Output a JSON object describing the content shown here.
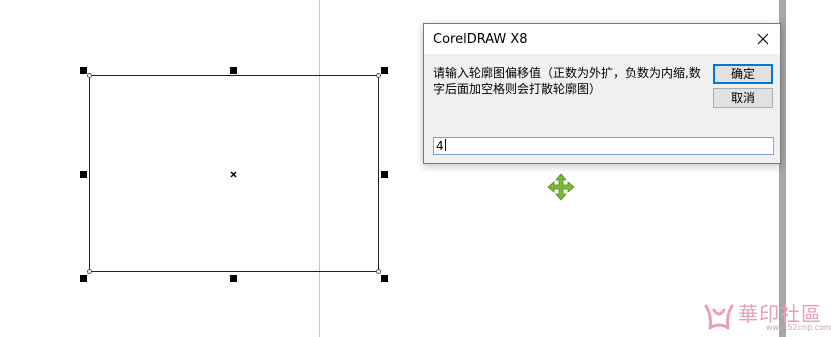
{
  "dialog": {
    "title": "CorelDRAW X8",
    "message": "请输入轮廓图偏移值（正数为外扩，负数为内缩,数字后面加空格则会打散轮廓图）",
    "ok_label": "确定",
    "cancel_label": "取消",
    "input_value": "4"
  },
  "icons": {
    "close": "close-icon",
    "move_cursor": "move-cursor-icon",
    "center_marker": "center-x-icon"
  },
  "watermark": {
    "text": "華印社區",
    "url": "www.52cnp.com"
  },
  "colors": {
    "dialog_accent": "#0078d7",
    "input_border": "#7aa7d9",
    "move_cursor": "#7ab83a",
    "watermark": "#e9a0b4"
  }
}
